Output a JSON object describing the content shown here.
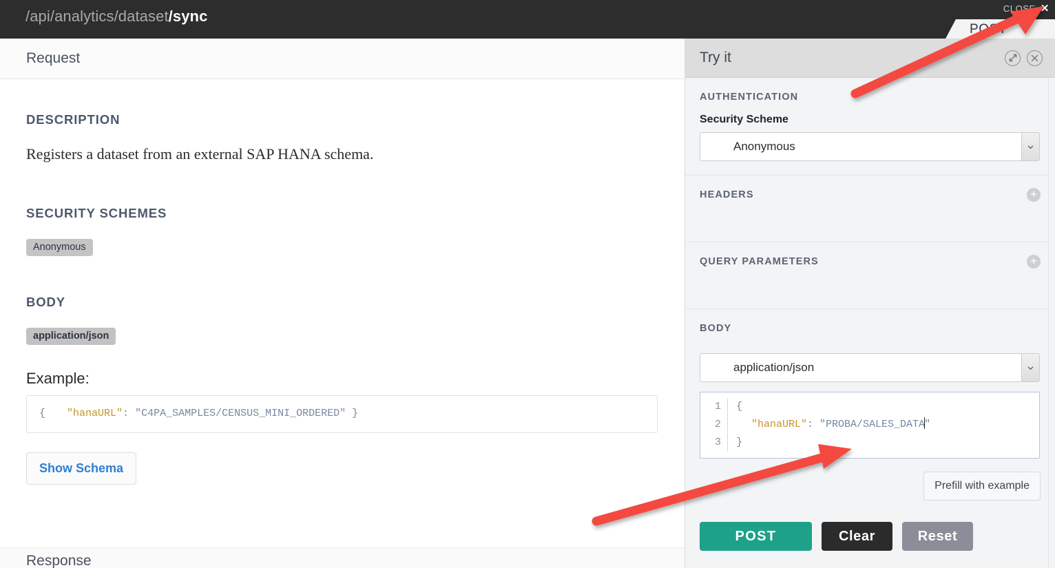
{
  "topbar": {
    "path_dim": "/api/analytics/dataset",
    "path_current": "/sync",
    "close_label": "CLOSE",
    "close_icon": "close-x-icon",
    "method_tab": "POST",
    "background": "#2d2d2d"
  },
  "left": {
    "header_title": "Request",
    "description_heading": "DESCRIPTION",
    "description_text": "Registers a dataset from an external SAP HANA schema.",
    "security_heading": "SECURITY SCHEMES",
    "security_chip": "Anonymous",
    "body_heading": "BODY",
    "body_chip": "application/json",
    "example_label": "Example:",
    "example_code": {
      "line1": "{",
      "key": "\"hanaURL\"",
      "colon": ": ",
      "value": "\"C4PA_SAMPLES/CENSUS_MINI_ORDERED\"",
      "line3": "}"
    },
    "show_schema_label": "Show Schema",
    "next_section_heading": "Response"
  },
  "tryit": {
    "title": "Try it",
    "expand_icon": "expand-diagonal-icon",
    "close_icon": "close-circle-icon",
    "authentication_label": "AUTHENTICATION",
    "security_scheme_label": "Security Scheme",
    "security_scheme_value": "Anonymous",
    "security_scheme_options": [
      "Anonymous"
    ],
    "headers_label": "HEADERS",
    "headers_add_icon": "plus-circle-icon",
    "query_parameters_label": "QUERY PARAMETERS",
    "query_add_icon": "plus-circle-icon",
    "body_label": "BODY",
    "body_content_type": "application/json",
    "body_content_type_options": [
      "application/json"
    ],
    "editor": {
      "line_numbers": [
        "1",
        "2",
        "3"
      ],
      "line1": "{",
      "key": "\"hanaURL\"",
      "colon": ": ",
      "value": "\"PROBA/SALES_DATA",
      "value_close_quote": "\"",
      "line3": "}"
    },
    "prefill_label": "Prefill with example",
    "post_label": "POST",
    "clear_label": "Clear",
    "reset_label": "Reset",
    "colors": {
      "post": "#1ea189",
      "clear": "#2b2b2b",
      "reset": "#8b8d98",
      "panel_bg": "#f2f4f6",
      "header_bg": "#dddddd",
      "annotation_arrow": "#f4483f"
    }
  }
}
